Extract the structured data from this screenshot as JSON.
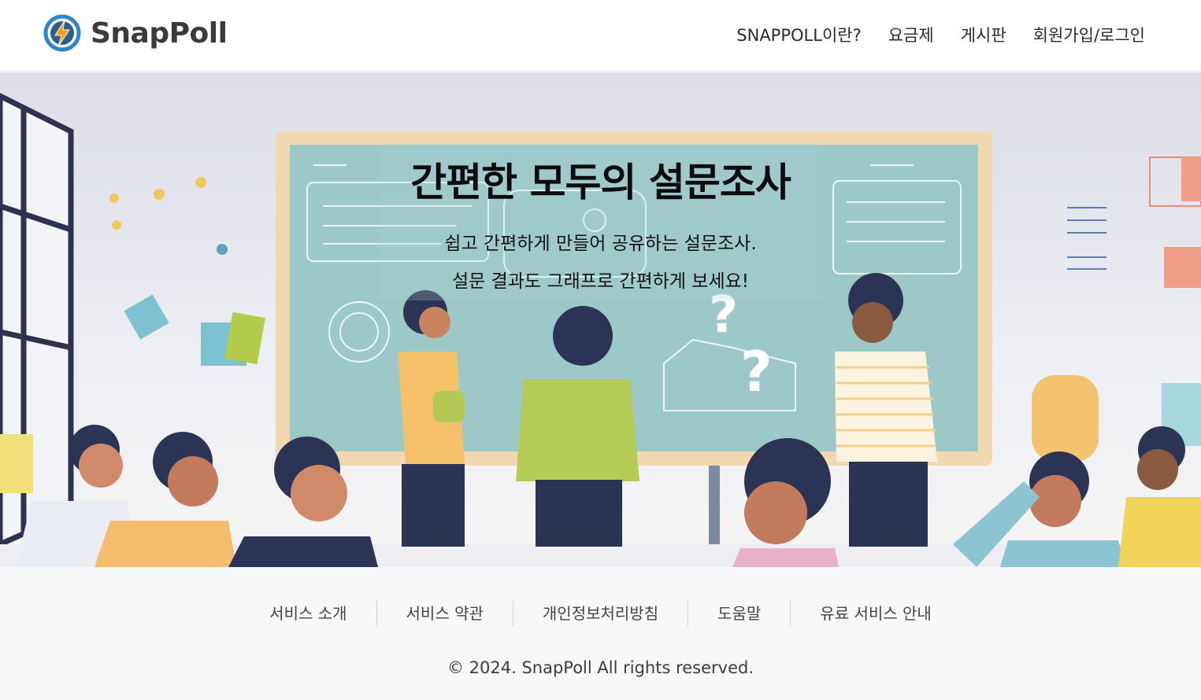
{
  "brand": {
    "name": "SnapPoll",
    "logo_icon": "lightning-bolt-icon",
    "colors": {
      "ring": "#2f86c7",
      "bolt": "#f39a1d"
    }
  },
  "nav": {
    "items": [
      {
        "label": "SNAPPOLL이란?"
      },
      {
        "label": "요금제"
      },
      {
        "label": "게시판"
      },
      {
        "label": "회원가입/로그인"
      }
    ]
  },
  "hero": {
    "title": "간편한 모두의 설문조사",
    "subtitle_line1": "쉽고 간편하게 만들어 공유하는 설문조사.",
    "subtitle_line2": "설문 결과도 그래프로 간편하게 보세요!",
    "background": "classroom-survey-illustration"
  },
  "footer": {
    "links": [
      {
        "label": "서비스 소개"
      },
      {
        "label": "서비스 약관"
      },
      {
        "label": "개인정보처리방침"
      },
      {
        "label": "도움말"
      },
      {
        "label": "유료 서비스 안내"
      }
    ],
    "copyright": "© 2024. SnapPoll All rights reserved."
  }
}
